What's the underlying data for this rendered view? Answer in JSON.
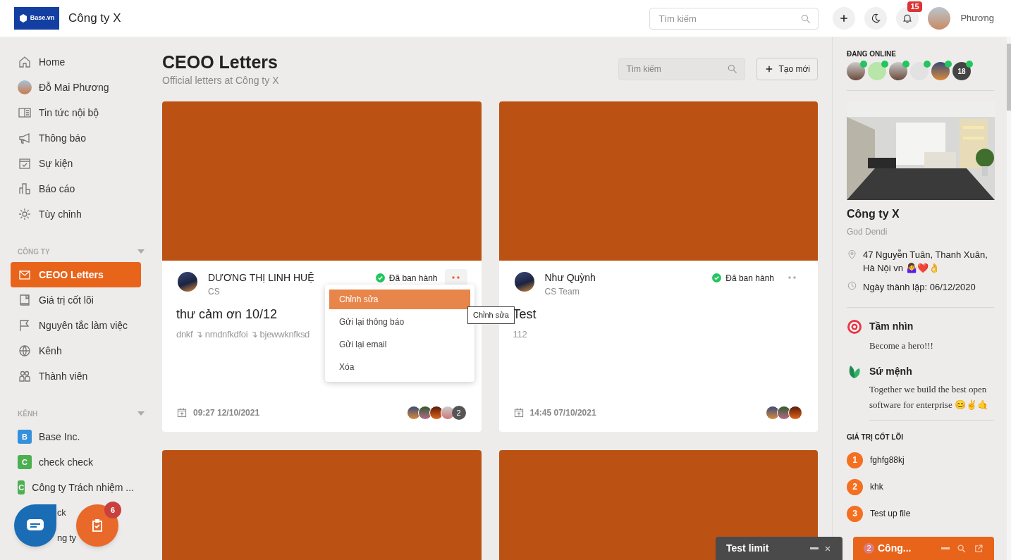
{
  "header": {
    "logo_text": "Base.vn",
    "company": "Công ty X",
    "search_placeholder": "Tìm kiếm",
    "notification_count": "15",
    "user_name": "Phương"
  },
  "sidebar": {
    "items": [
      {
        "kind": "link",
        "label": "Home",
        "selected": false
      },
      {
        "kind": "avatar",
        "label": "Đỗ Mai Phương",
        "selected": false
      },
      {
        "kind": "link",
        "label": "Tin tức nội bộ",
        "selected": false
      },
      {
        "kind": "link",
        "label": "Thông báo",
        "selected": false
      },
      {
        "kind": "link",
        "label": "Sự kiện",
        "selected": false
      },
      {
        "kind": "link",
        "label": "Báo cáo",
        "selected": false
      },
      {
        "kind": "link",
        "label": "Tùy chỉnh",
        "selected": false
      }
    ],
    "sections": [
      {
        "title": "CÔNG TY",
        "items": [
          {
            "kind": "link",
            "label": "CEOO Letters",
            "selected": true
          },
          {
            "kind": "link",
            "label": "Giá trị cốt lõi",
            "selected": false
          },
          {
            "kind": "link",
            "label": "Nguyên tắc làm việc",
            "selected": false
          },
          {
            "kind": "link",
            "label": "Kênh",
            "selected": false
          },
          {
            "kind": "link",
            "label": "Thành viên",
            "selected": false
          }
        ]
      },
      {
        "title": "KÊNH",
        "items": [
          {
            "kind": "channel",
            "letter": "B",
            "color": "#3390dc",
            "label": "Base Inc.",
            "selected": false
          },
          {
            "kind": "channel",
            "letter": "C",
            "color": "#4caf50",
            "label": "check check",
            "selected": false
          },
          {
            "kind": "channel",
            "letter": "C",
            "color": "#4caf50",
            "label": "Công ty Trách nhiệm ...",
            "selected": false
          },
          {
            "kind": "covered",
            "label": "ck",
            "selected": false
          },
          {
            "kind": "covered",
            "label": "ng ty",
            "selected": false
          }
        ]
      }
    ]
  },
  "main": {
    "title": "CEOO Letters",
    "subtitle": "Official letters at Công ty X",
    "search_placeholder": "Tìm kiếm",
    "create_label": "Tạo mới",
    "cards": [
      {
        "kind": "letter",
        "author": "DƯƠNG THỊ LINH HUỆ",
        "team": "CS",
        "status": "Đã ban hành",
        "title": "thư cảm ơn 10/12",
        "excerpt": "dnkf ↴ nmdnfkdfoi ↴ bjewwknfksd",
        "time": "09:27 12/10/2021",
        "more": "2",
        "menu_open": true
      },
      {
        "kind": "letter",
        "author": "Như Quỳnh",
        "team": "CS Team",
        "status": "Đã ban hành",
        "title": "Test",
        "excerpt": "112",
        "time": "14:45 07/10/2021",
        "menu_open": false
      },
      {
        "kind": "cover"
      },
      {
        "kind": "cover"
      }
    ],
    "menu": {
      "items": [
        {
          "label": "Chỉnh sửa",
          "selected": true
        },
        {
          "label": "Gửi lại thông báo",
          "selected": false
        },
        {
          "label": "Gửi lại email",
          "selected": false
        },
        {
          "label": "Xóa",
          "selected": false
        }
      ],
      "tooltip": "Chỉnh sửa"
    }
  },
  "right": {
    "online_title": "ĐANG ONLINE",
    "online_more": "18",
    "company": "Công ty X",
    "tagline": "God Dendi",
    "address": "47 Nguyễn Tuân, Thanh Xuân, Hà Nội vn 🤷‍♀️❤️👌",
    "founded": "Ngày thành lập: 06/12/2020",
    "vision_title": "Tầm nhìn",
    "vision": "Become a hero!!!",
    "mission_title": "Sứ mệnh",
    "mission": "Together we build the best open software for enterprise 😊✌🤙",
    "values_title": "GIÁ TRỊ CỐT LÕI",
    "values": [
      {
        "number": "1",
        "label": "fghfg88kj"
      },
      {
        "number": "2",
        "label": "khk"
      },
      {
        "number": "3",
        "label": "Test up file"
      }
    ]
  },
  "floating": {
    "task_badge": "6"
  },
  "chat_bars": [
    {
      "kind": "dark",
      "title": "Test limit"
    },
    {
      "kind": "orange",
      "count": "2",
      "title": "Công..."
    }
  ]
}
